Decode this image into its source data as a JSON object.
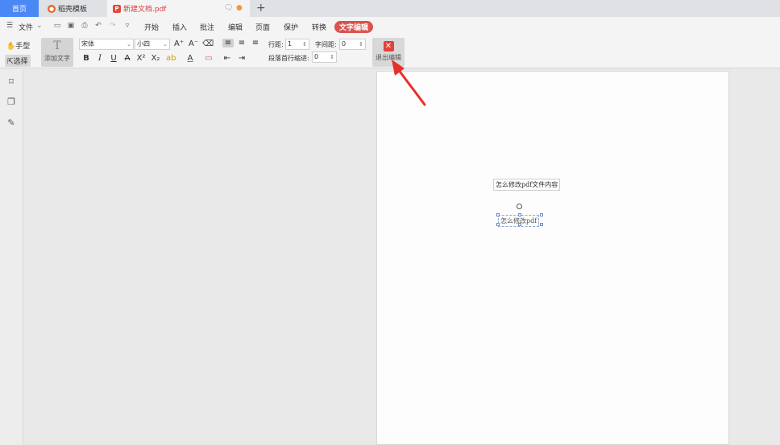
{
  "tabs": {
    "home": "首页",
    "template": "稻壳模板",
    "document": "新建文档.pdf"
  },
  "menu": {
    "file": "文件",
    "items": [
      "开始",
      "插入",
      "批注",
      "编辑",
      "页面",
      "保护",
      "转换",
      "文字编辑"
    ]
  },
  "toolbar": {
    "hand": "手型",
    "select": "选择",
    "add_text": "添加文字",
    "font_name": "宋体",
    "font_size": "小四",
    "line_spacing_label": "行距:",
    "line_spacing_value": "1",
    "char_spacing_label": "字间距:",
    "char_spacing_value": "0",
    "indent_label": "段落首行缩进:",
    "indent_value": "0",
    "exit_edit": "退出编辑"
  },
  "document": {
    "text1": "怎么修改pdf文件内容",
    "text2": "怎么修改pdf"
  },
  "colors": {
    "accent": "#4a88f5",
    "active_menu": "#d9534f",
    "exit_button": "#e0433a",
    "annotation_arrow": "#e8302a"
  }
}
